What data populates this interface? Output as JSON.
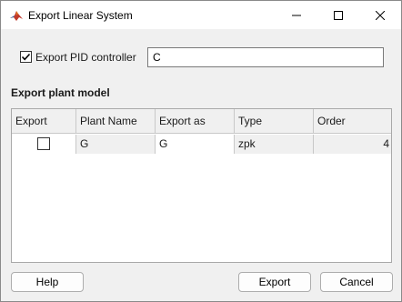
{
  "window": {
    "title": "Export Linear System",
    "icon": "matlab-icon",
    "controls": [
      "minimize-icon",
      "maximize-icon",
      "close-icon"
    ]
  },
  "pid": {
    "checkbox_checked": true,
    "label": "Export PID controller",
    "value": "C"
  },
  "plant": {
    "section_title": "Export plant model",
    "columns": [
      "Export",
      "Plant Name",
      "Export as",
      "Type",
      "Order"
    ],
    "rows": [
      {
        "export": false,
        "plant_name": "G",
        "export_as": "G",
        "type": "zpk",
        "order": "4"
      }
    ]
  },
  "buttons": {
    "help": "Help",
    "export": "Export",
    "cancel": "Cancel"
  }
}
